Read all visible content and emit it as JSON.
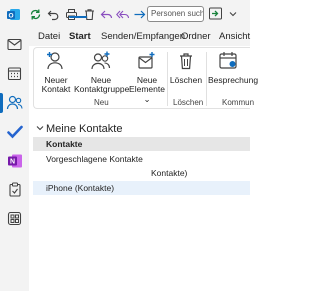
{
  "quick_access": {
    "search_placeholder": "Personen suchen"
  },
  "tabs": [
    {
      "label": "Datei"
    },
    {
      "label": "Start"
    },
    {
      "label": "Senden/Empfangen"
    },
    {
      "label": "Ordner"
    },
    {
      "label": "Ansicht"
    }
  ],
  "ribbon": {
    "neu_group": {
      "label": "Neu",
      "new_contact": {
        "line1": "Neuer",
        "line2": "Kontakt"
      },
      "new_contact_group": {
        "line1": "Neue",
        "line2": "Kontaktgruppe"
      },
      "new_items": {
        "line1": "Neue",
        "line2": "Elemente ⌄"
      }
    },
    "delete_group": {
      "label": "Löschen",
      "delete": {
        "line1": "Löschen"
      }
    },
    "communicate_group": {
      "label": "Kommun",
      "meeting": {
        "line1": "Besprechung"
      }
    }
  },
  "folder_pane": {
    "section_title": "Meine Kontakte",
    "items": [
      {
        "label": "Kontakte",
        "selected": true
      },
      {
        "label": "Vorgeschlagene Kontakte",
        "selected": false
      },
      {
        "label": "Kontakte)",
        "selected": false
      },
      {
        "label": "iPhone (Kontakte)",
        "selected": false,
        "hover": true
      }
    ]
  },
  "colors": {
    "accent": "#0f6cbd",
    "chrome": "#f3f3f3",
    "selected_row": "#e6e6e6",
    "hover_row": "#e8f1fb"
  },
  "rail_icons": [
    "mail-icon",
    "calendar-icon",
    "people-icon",
    "todo-icon",
    "onenote-icon",
    "clipboard-icon",
    "apps-icon"
  ]
}
